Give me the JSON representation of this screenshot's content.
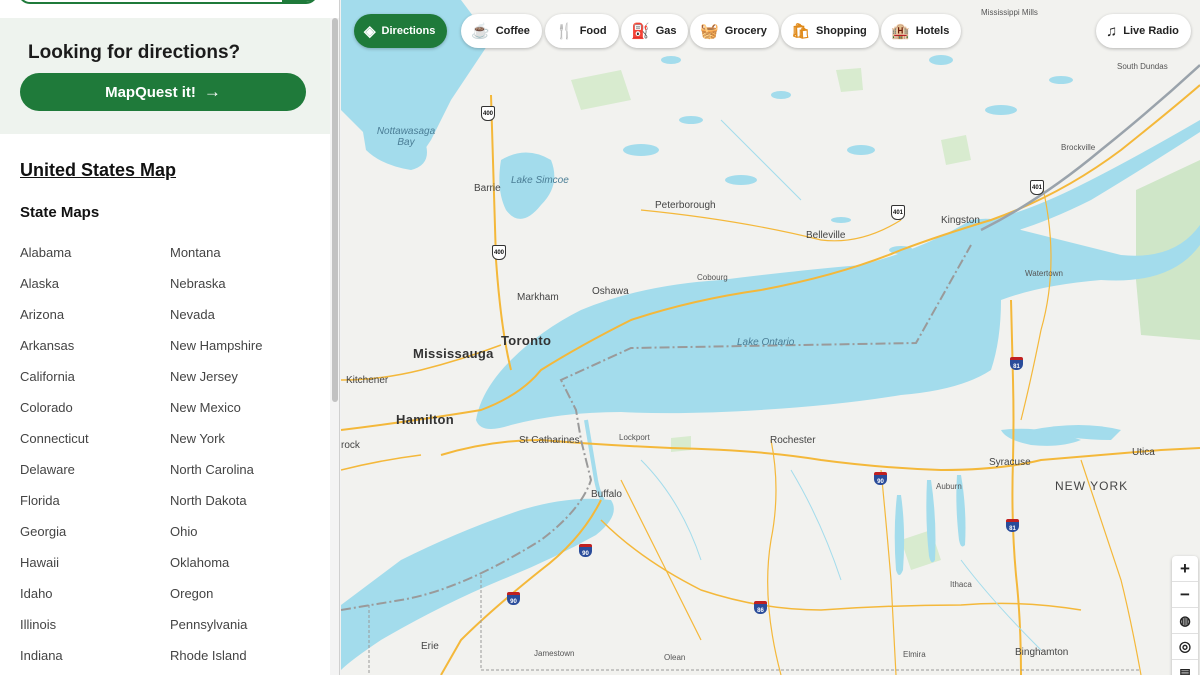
{
  "sidebar": {
    "promo_title": "Looking for directions?",
    "promo_button": "MapQuest it!",
    "us_map_link": "United States Map",
    "state_maps_heading": "State Maps",
    "states_col1": [
      "Alabama",
      "Alaska",
      "Arizona",
      "Arkansas",
      "California",
      "Colorado",
      "Connecticut",
      "Delaware",
      "Florida",
      "Georgia",
      "Hawaii",
      "Idaho",
      "Illinois",
      "Indiana"
    ],
    "states_col2": [
      "Montana",
      "Nebraska",
      "Nevada",
      "New Hampshire",
      "New Jersey",
      "New Mexico",
      "New York",
      "North Carolina",
      "North Dakota",
      "Ohio",
      "Oklahoma",
      "Oregon",
      "Pennsylvania",
      "Rhode Island"
    ]
  },
  "chips": [
    {
      "label": "Directions",
      "icon": "directions-icon"
    },
    {
      "label": "Coffee",
      "icon": "coffee-icon"
    },
    {
      "label": "Food",
      "icon": "food-icon"
    },
    {
      "label": "Gas",
      "icon": "gas-icon"
    },
    {
      "label": "Grocery",
      "icon": "grocery-icon"
    },
    {
      "label": "Shopping",
      "icon": "shopping-icon"
    },
    {
      "label": "Hotels",
      "icon": "hotel-icon"
    },
    {
      "label": "Live Radio",
      "icon": "music-icon"
    }
  ],
  "map": {
    "labels": {
      "mississippi_mills": "Mississippi Mills",
      "south_dundas": "South Dundas",
      "nottawasaga_bay": "Nottawasaga Bay",
      "lake_simcoe": "Lake Simcoe",
      "barrie": "Barrie",
      "peterborough": "Peterborough",
      "belleville": "Belleville",
      "kingston": "Kingston",
      "brockville": "Brockville",
      "markham": "Markham",
      "oshawa": "Oshawa",
      "cobourg": "Cobourg",
      "watertown": "Watertown",
      "toronto": "Toronto",
      "mississauga": "Mississauga",
      "lake_ontario": "Lake Ontario",
      "kitchener": "Kitchener",
      "hamilton": "Hamilton",
      "st_catharines": "St Catharines",
      "lockport": "Lockport",
      "rochester": "Rochester",
      "syracuse": "Syracuse",
      "utica": "Utica",
      "buffalo": "Buffalo",
      "auburn": "Auburn",
      "new_york": "NEW YORK",
      "ithaca": "Ithaca",
      "erie": "Erie",
      "jamestown": "Jamestown",
      "olean": "Olean",
      "elmira": "Elmira",
      "binghamton": "Binghamton",
      "brock": "rock"
    },
    "shields": {
      "h400a": "400",
      "h400b": "400",
      "h401a": "401",
      "h401b": "401",
      "i81a": "81",
      "i81b": "81",
      "i90a": "90",
      "i90b": "90",
      "i90c": "90",
      "i86": "86"
    }
  },
  "controls": {
    "zoom_in": "+",
    "zoom_out": "−"
  },
  "colors": {
    "brand_green": "#1f7a3a",
    "water": "#a3dcec",
    "road": "#f4b83a"
  }
}
